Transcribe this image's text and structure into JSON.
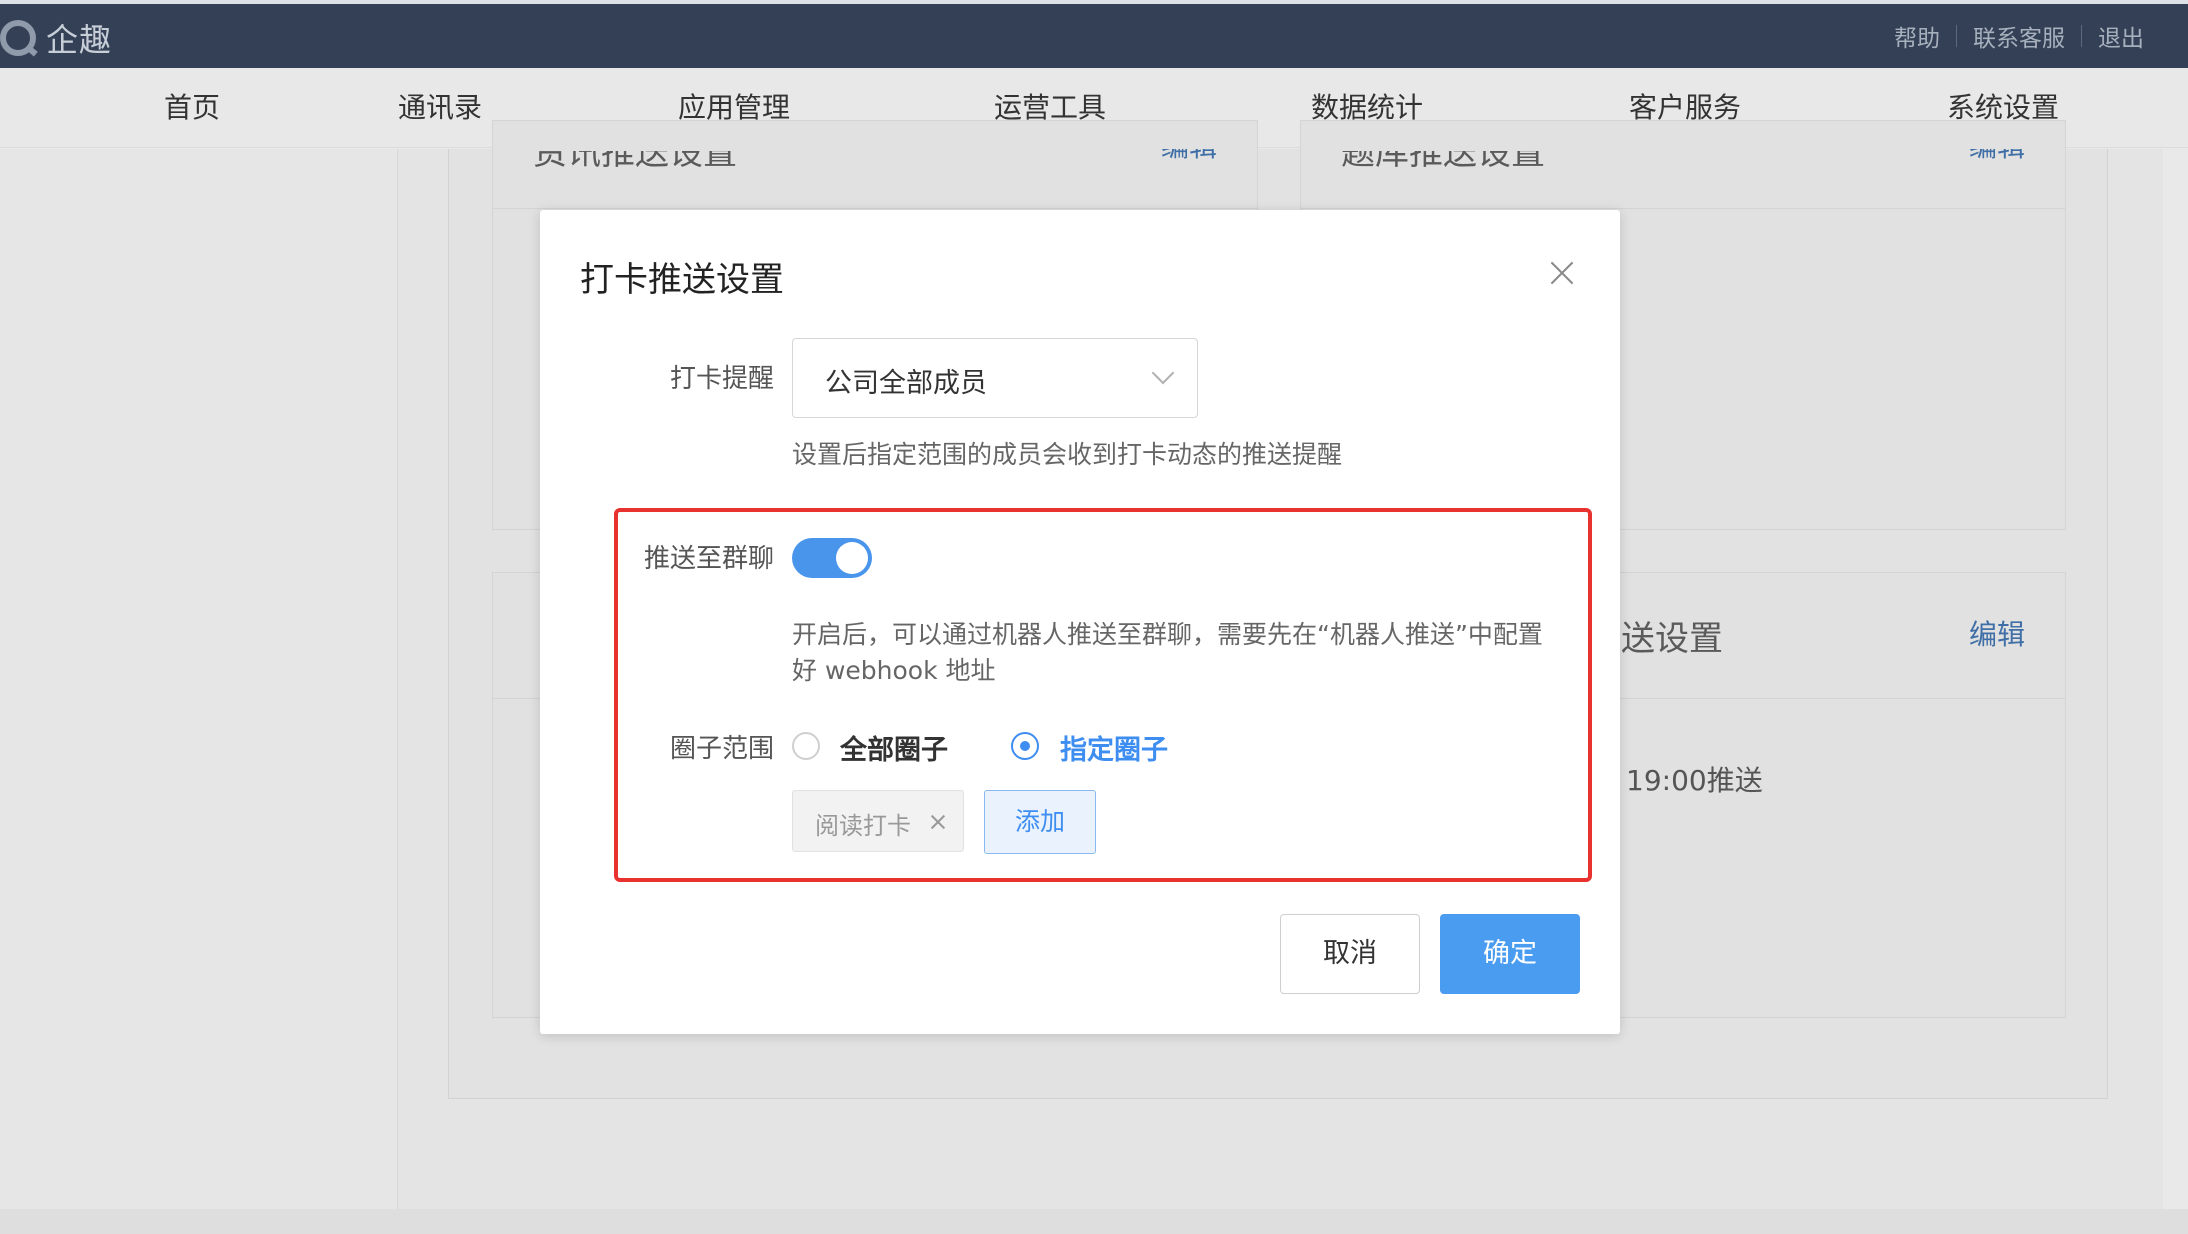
{
  "app": {
    "brand_name": "企趣",
    "top_links": [
      "帮助",
      "联系客服",
      "退出"
    ]
  },
  "nav": {
    "items": [
      "首页",
      "通讯录",
      "应用管理",
      "运营工具",
      "数据统计",
      "客户服务",
      "系统设置"
    ],
    "active": "运营工具"
  },
  "background": {
    "card_tl_title": "资讯推送设置",
    "card_tr_title": "题库推送设置",
    "card_br_title": "送设置",
    "card_edit_label": "编辑",
    "card_br_text": "19:00推送"
  },
  "modal": {
    "title": "打卡推送设置",
    "reminder_label": "打卡提醒",
    "reminder_value": "公司全部成员",
    "reminder_hint": "设置后指定范围的成员会收到打卡动态的推送提醒",
    "push_group_label": "推送至群聊",
    "push_group_enabled": true,
    "push_group_hint_line1": "开启后，可以通过机器人推送至群聊，需要先在“机器人推送”中配置",
    "push_group_hint_line2": "好 webhook 地址",
    "scope_label": "圈子范围",
    "scope_options": [
      "全部圈子",
      "指定圈子"
    ],
    "scope_selected": "指定圈子",
    "selected_tags": [
      "阅读打卡"
    ],
    "add_label": "添加",
    "cancel_label": "取消",
    "confirm_label": "确定"
  },
  "colors": {
    "topbar": "#334055",
    "accent": "#3e8df0",
    "highlight": "#e8322f"
  }
}
